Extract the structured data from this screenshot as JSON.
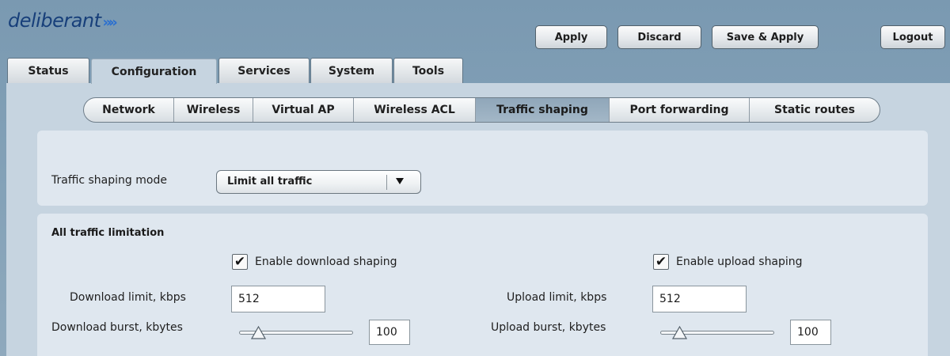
{
  "brand": {
    "logo_text": "deliberant",
    "logo_mark": "»"
  },
  "toolbar": {
    "apply_label": "Apply",
    "discard_label": "Discard",
    "save_apply_label": "Save & Apply",
    "logout_label": "Logout"
  },
  "main_tabs": {
    "status": "Status",
    "configuration": "Configuration",
    "services": "Services",
    "system": "System",
    "tools": "Tools",
    "active": "Configuration"
  },
  "sub_tabs": {
    "network": "Network",
    "wireless": "Wireless",
    "virtual_ap": "Virtual AP",
    "wireless_acl": "Wireless ACL",
    "traffic_shaping": "Traffic shaping",
    "port_forwarding": "Port forwarding",
    "static_routes": "Static routes",
    "active": "Traffic shaping"
  },
  "mode": {
    "label": "Traffic shaping mode",
    "selected": "Limit all traffic"
  },
  "limits": {
    "section_title": "All traffic limitation",
    "download": {
      "enable_label": "Enable download shaping",
      "enabled": true,
      "check_mark": "✔",
      "limit_label": "Download limit, kbps",
      "limit_value": "512",
      "burst_label": "Download burst, kbytes",
      "burst_value": "100"
    },
    "upload": {
      "enable_label": "Enable upload shaping",
      "enabled": true,
      "check_mark": "✔",
      "limit_label": "Upload limit, kbps",
      "limit_value": "512",
      "burst_label": "Upload burst, kbytes",
      "burst_value": "100"
    }
  },
  "colors": {
    "header_bg": "#7f9db4",
    "content_bg": "#c6d4e0",
    "panel_bg": "#dfe7ef",
    "logo": "#173f7a",
    "logo_mark": "#2a6fd0"
  }
}
